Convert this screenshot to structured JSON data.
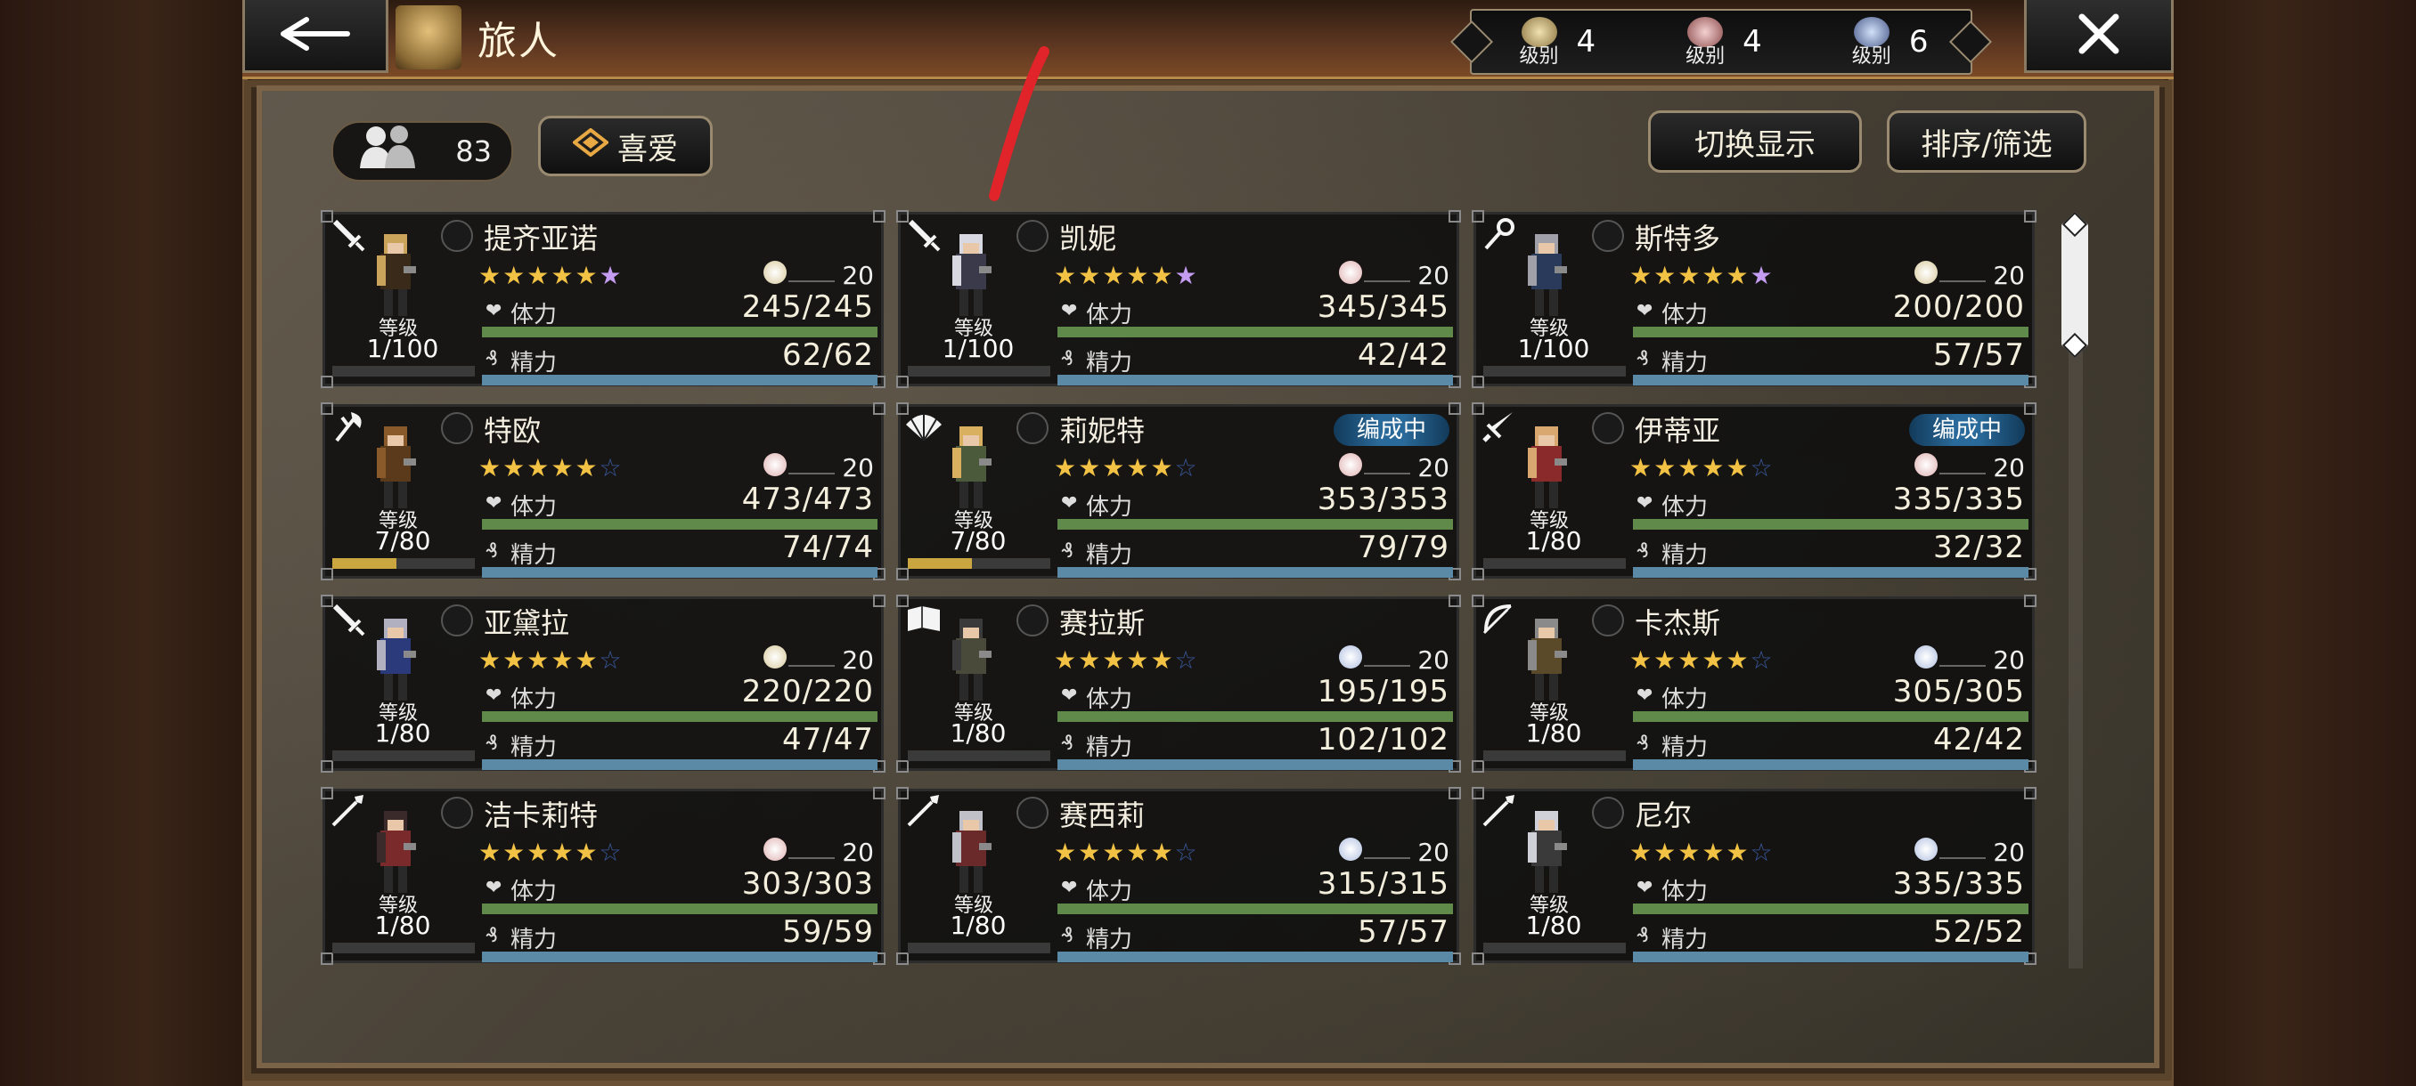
{
  "header": {
    "title": "旅人",
    "ranks": [
      {
        "label": "级别",
        "count": "4",
        "color": "#c8b47a"
      },
      {
        "label": "级别",
        "count": "4",
        "color": "#d8a0a0"
      },
      {
        "label": "级别",
        "count": "6",
        "color": "#9fb0d0"
      }
    ]
  },
  "toolbar": {
    "traveler_count": "83",
    "favorite_label": "喜爱",
    "switch_view_label": "切换显示",
    "sort_filter_label": "排序/筛选"
  },
  "labels": {
    "level": "等级",
    "hp": "体力",
    "sp": "精力",
    "formed": "编成中"
  },
  "travelers": [
    {
      "name": "提齐亚诺",
      "weapon_icon": "sword-icon",
      "stars": 5,
      "top_star": true,
      "rank": "20",
      "rank_color": "#d8c89a",
      "level": "1/100",
      "exp": 0,
      "hp": "245/245",
      "sp": "62/62",
      "formed": false,
      "hair": "#c9a45a",
      "cloth": "#3a2a1a"
    },
    {
      "name": "凯妮",
      "weapon_icon": "sword-icon",
      "stars": 5,
      "top_star": true,
      "rank": "20",
      "rank_color": "#e0b0b0",
      "level": "1/100",
      "exp": 0,
      "hp": "345/345",
      "sp": "42/42",
      "formed": false,
      "hair": "#d8d8e0",
      "cloth": "#3a3a4a"
    },
    {
      "name": "斯特多",
      "weapon_icon": "staff-icon",
      "stars": 5,
      "top_star": true,
      "rank": "20",
      "rank_color": "#d8c89a",
      "level": "1/100",
      "exp": 0,
      "hp": "200/200",
      "sp": "57/57",
      "formed": false,
      "hair": "#a0a0a8",
      "cloth": "#2a3a5a"
    },
    {
      "name": "特欧",
      "weapon_icon": "axe-icon",
      "stars": 5,
      "top_star": false,
      "rank": "20",
      "rank_color": "#e0b0b0",
      "level": "7/80",
      "exp": 0.45,
      "hp": "473/473",
      "sp": "74/74",
      "formed": false,
      "hair": "#8a5a2a",
      "cloth": "#5a3a1a"
    },
    {
      "name": "莉妮特",
      "weapon_icon": "fan-icon",
      "stars": 5,
      "top_star": false,
      "rank": "20",
      "rank_color": "#e0b0b0",
      "level": "7/80",
      "exp": 0.45,
      "hp": "353/353",
      "sp": "79/79",
      "formed": true,
      "hair": "#d8b060",
      "cloth": "#4a5a3a"
    },
    {
      "name": "伊蒂亚",
      "weapon_icon": "dagger-icon",
      "stars": 5,
      "top_star": false,
      "rank": "20",
      "rank_color": "#e0b0b0",
      "level": "1/80",
      "exp": 0,
      "hp": "335/335",
      "sp": "32/32",
      "formed": true,
      "hair": "#d8a870",
      "cloth": "#8a2a2a"
    },
    {
      "name": "亚黛拉",
      "weapon_icon": "sword-icon",
      "stars": 5,
      "top_star": false,
      "rank": "20",
      "rank_color": "#d8c89a",
      "level": "1/80",
      "exp": 0,
      "hp": "220/220",
      "sp": "47/47",
      "formed": false,
      "hair": "#b0b0c0",
      "cloth": "#2a3a7a"
    },
    {
      "name": "赛拉斯",
      "weapon_icon": "book-icon",
      "stars": 5,
      "top_star": false,
      "rank": "20",
      "rank_color": "#b0c0e0",
      "level": "1/80",
      "exp": 0,
      "hp": "195/195",
      "sp": "102/102",
      "formed": false,
      "hair": "#3a3a3a",
      "cloth": "#4a4a3a"
    },
    {
      "name": "卡杰斯",
      "weapon_icon": "bow-icon",
      "stars": 5,
      "top_star": false,
      "rank": "20",
      "rank_color": "#b0c0e0",
      "level": "1/80",
      "exp": 0,
      "hp": "305/305",
      "sp": "42/42",
      "formed": false,
      "hair": "#8a8a8a",
      "cloth": "#5a4a2a"
    },
    {
      "name": "洁卡莉特",
      "weapon_icon": "spear-icon",
      "stars": 5,
      "top_star": false,
      "rank": "20",
      "rank_color": "#e0b0b0",
      "level": "1/80",
      "exp": 0,
      "hp": "303/303",
      "sp": "59/59",
      "formed": false,
      "hair": "#3a2a2a",
      "cloth": "#7a2a2a"
    },
    {
      "name": "赛西莉",
      "weapon_icon": "spear-icon",
      "stars": 5,
      "top_star": false,
      "rank": "20",
      "rank_color": "#b0c0e0",
      "level": "1/80",
      "exp": 0,
      "hp": "315/315",
      "sp": "57/57",
      "formed": false,
      "hair": "#c0c0c8",
      "cloth": "#6a2a2a"
    },
    {
      "name": "尼尔",
      "weapon_icon": "spear-icon",
      "stars": 5,
      "top_star": false,
      "rank": "20",
      "rank_color": "#b0c0e0",
      "level": "1/80",
      "exp": 0,
      "hp": "335/335",
      "sp": "52/52",
      "formed": false,
      "hair": "#d0d0d8",
      "cloth": "#3a3a3a"
    }
  ]
}
